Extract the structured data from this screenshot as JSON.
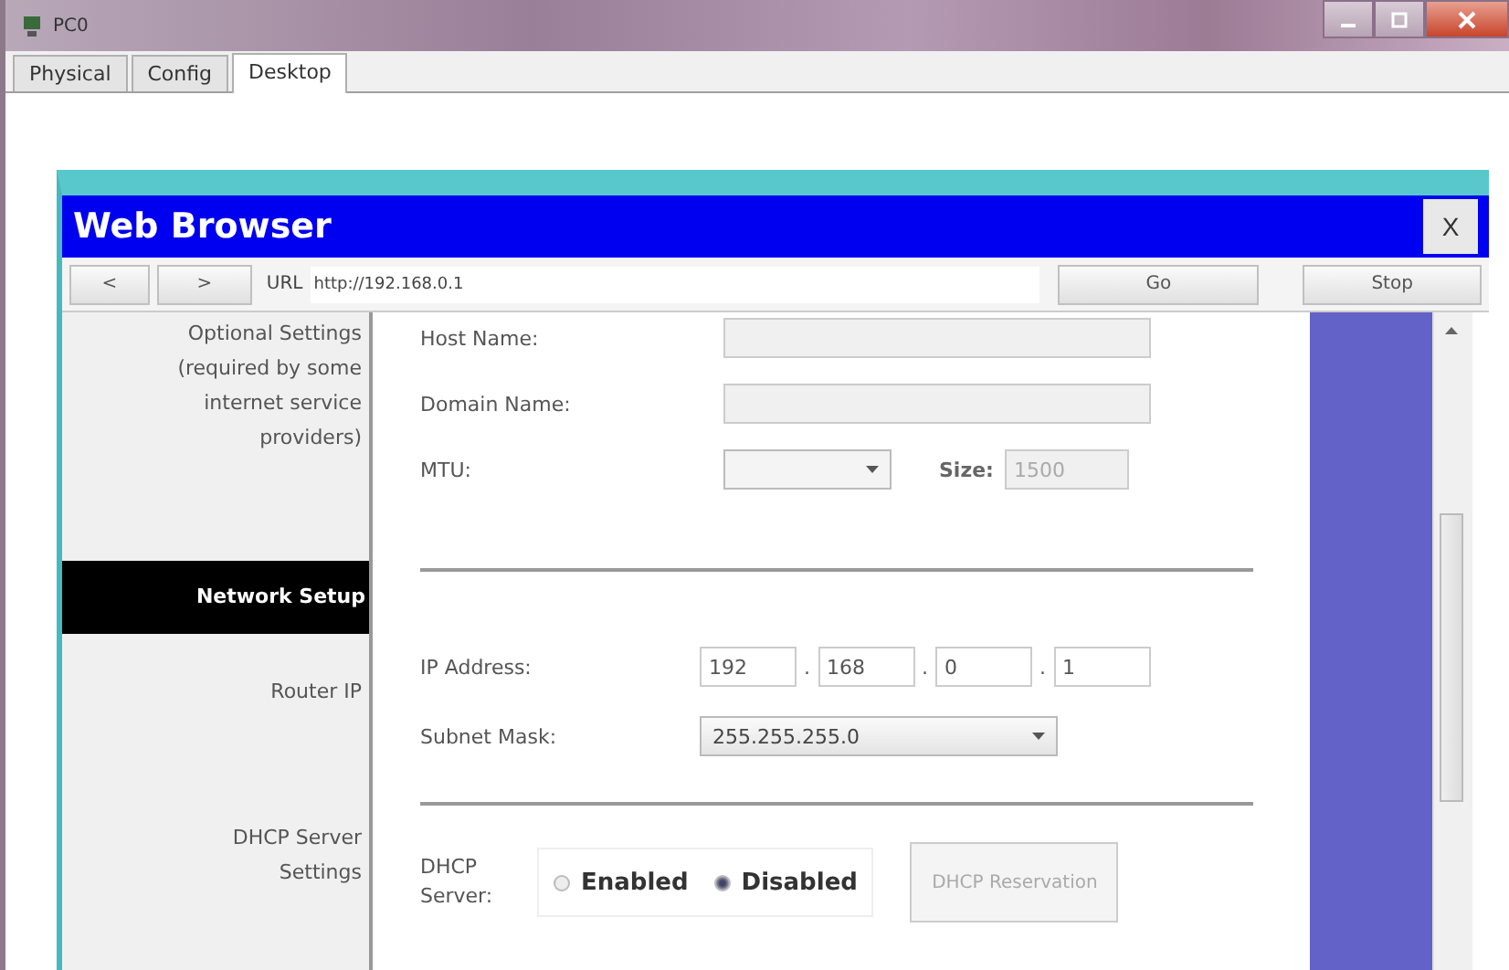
{
  "window": {
    "title": "PC0"
  },
  "tabs": [
    {
      "label": "Physical",
      "selected": false
    },
    {
      "label": "Config",
      "selected": false
    },
    {
      "label": "Desktop",
      "selected": true
    }
  ],
  "browser": {
    "title": "Web Browser",
    "close": "X",
    "back": "<",
    "forward": ">",
    "url_label": "URL",
    "url": "http://192.168.0.1",
    "go": "Go",
    "stop": "Stop"
  },
  "sidebar": {
    "items": [
      {
        "label": "Optional Settings (required by some internet service providers)",
        "kind": "label"
      },
      {
        "label": "Network Setup",
        "kind": "header"
      },
      {
        "label": "Router IP",
        "kind": "label"
      },
      {
        "label": "DHCP Server Settings",
        "kind": "label"
      }
    ]
  },
  "form": {
    "host_name": {
      "label": "Host Name:",
      "disabled": true
    },
    "domain_name": {
      "label": "Domain Name:",
      "disabled": true
    },
    "mtu": {
      "label": "MTU:",
      "disabled": true
    },
    "size": {
      "label": "Size:",
      "value": "1500",
      "disabled": true
    },
    "ip_address": {
      "label": "IP Address:",
      "octets": [
        "192",
        "168",
        "0",
        "1"
      ],
      "separators": [
        ".",
        ".",
        "."
      ]
    },
    "subnet_mask": {
      "label": "Subnet Mask:",
      "value": "255.255.255.0"
    },
    "dhcp_server": {
      "label": "DHCP Server:",
      "options": [
        {
          "label": "Enabled",
          "selected": false
        },
        {
          "label": "Disabled",
          "selected": true
        }
      ]
    },
    "reservation": {
      "label": "DHCP Reservation",
      "disabled": true
    }
  }
}
